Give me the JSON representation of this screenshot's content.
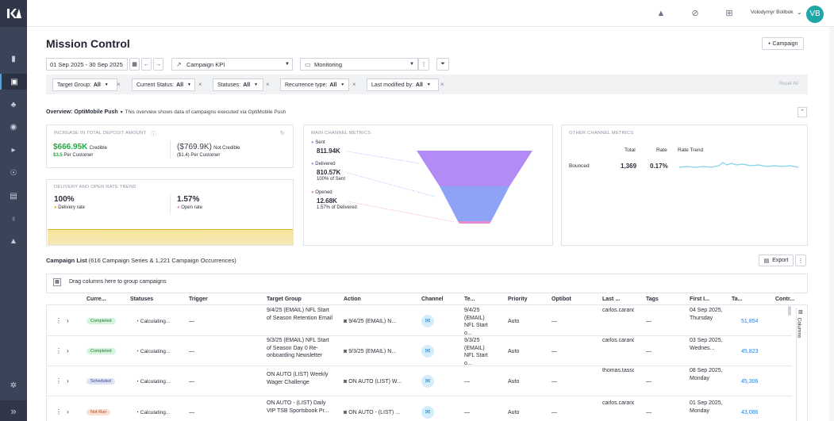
{
  "colors": {
    "sidebar": "#3a4358",
    "accent": "#4aa3df",
    "green": "#27a745",
    "funnel_sent": "#b28bf5",
    "funnel_delivered": "#8ea3f5",
    "funnel_opened": "#e78ad1",
    "trend_line": "#7fd3ea"
  },
  "topbar": {
    "user_name": "Volodymyr Bolibok",
    "avatar_initials": "VB"
  },
  "page": {
    "title": "Mission Control",
    "add_campaign": "+ Campaign"
  },
  "toolbar": {
    "date_range": "01 Sep 2025 - 30 Sep 2025",
    "kpi_select": "Campaign KPI",
    "monitor_select": "Monitoring"
  },
  "filters": [
    {
      "label": "Target Group:",
      "value": "All"
    },
    {
      "label": "Current Status:",
      "value": "All"
    },
    {
      "label": "Statuses:",
      "value": "All"
    },
    {
      "label": "Recurrence type:",
      "value": "All"
    },
    {
      "label": "Last modified by:",
      "value": "All"
    }
  ],
  "reset_all": "Reset All",
  "overview": {
    "label": "Overview:",
    "channel": "OptiMobile Push",
    "description": "This overview shows data of campaigns executed via OptiMobile Push"
  },
  "deposit": {
    "title": "INCREASE IN TOTAL DEPOSIT AMOUNT",
    "credible_value": "$666.95K",
    "credible_label": "Credible",
    "credible_per": "$3.5",
    "per_customer": "Per Customer",
    "noncredible_value": "($769.9K)",
    "noncredible_label": "Not Credible",
    "noncredible_per": "($1.4)",
    "noncredible_per_label": "Per Customer"
  },
  "delivery": {
    "title": "DELIVERY AND OPEN RATE TREND",
    "delivery_value": "100%",
    "delivery_label": "Delivery rate",
    "open_value": "1.57%",
    "open_label": "Open rate"
  },
  "main_channel": {
    "title": "MAIN CHANNEL METRICS",
    "sent_label": "Sent",
    "sent_value": "811.94K",
    "delivered_label": "Delivered",
    "delivered_value": "810.57K",
    "delivered_sub": "100% of Sent",
    "opened_label": "Opened",
    "opened_value": "12.68K",
    "opened_sub": "1.57% of Delivered"
  },
  "other_channel": {
    "title": "OTHER CHANNEL METRICS",
    "col_total": "Total",
    "col_rate": "Rate",
    "col_trend": "Rate Trend",
    "row_label": "Bounced",
    "row_total": "1,369",
    "row_rate": "0.17%"
  },
  "campaign_list": {
    "title": "Campaign List",
    "subtitle": "(616 Campaign Series & 1,221 Campaign Occurrences)",
    "export": "Export",
    "group_hint": "Drag columns here to group campaigns",
    "columns_panel": "Columns"
  },
  "columns": [
    "Curre...",
    "Statuses",
    "Trigger",
    "Target Group",
    "Action",
    "Channel",
    "Te...",
    "Priority",
    "Optibot",
    "Last ...",
    "Tags",
    "First I...",
    "Ta...",
    "Contr..."
  ],
  "rows": [
    {
      "status": "Completed",
      "statuses": "Calculating...",
      "trigger": "—",
      "target": "9/4/25 (EMAIL) NFL Start of Season Retention Email",
      "action": "9/4/25 (EMAIL) N...",
      "te": "9/4/25 (EMAIL) NFL Start o...",
      "priority": "Auto",
      "optibot": "—",
      "last": "carlos.carandang@thescore.c...",
      "tags": "—",
      "first": "04 Sep 2025, Thursday",
      "ta": "51,854"
    },
    {
      "status": "Completed",
      "statuses": "Calculating...",
      "trigger": "—",
      "target": "9/3/25 (EMAIL) NFL Start of Season Day 0 Re-onboarding Newsletter",
      "action": "9/3/25 (EMAIL) N...",
      "te": "9/3/25 (EMAIL) NFL Start o...",
      "priority": "Auto",
      "optibot": "—",
      "last": "carlos.carandang@thescore.c...",
      "tags": "—",
      "first": "03 Sep 2025, Wednes...",
      "ta": "45,823"
    },
    {
      "status": "Scheduled",
      "statuses": "Calculating...",
      "trigger": "—",
      "target": "ON AUTO (LIST) Weekly Wager Challenge",
      "action": "ON AUTO (LIST) W...",
      "te": "—",
      "priority": "Auto",
      "optibot": "—",
      "last": "thomas.tassone@thescore.c...",
      "tags": "—",
      "first": "08 Sep 2025, Monday",
      "ta": "45,306"
    },
    {
      "status": "Not Run",
      "statuses": "Calculating...",
      "trigger": "—",
      "target": "ON AUTO - (LIST) Daily VIP TSB Sportsbook Pr...",
      "action": "ON AUTO - (LIST) ...",
      "te": "—",
      "priority": "Auto",
      "optibot": "—",
      "last": "carlos.carandang@thescore.c...",
      "tags": "—",
      "first": "01 Sep 2025, Monday",
      "ta": "43,086"
    }
  ]
}
